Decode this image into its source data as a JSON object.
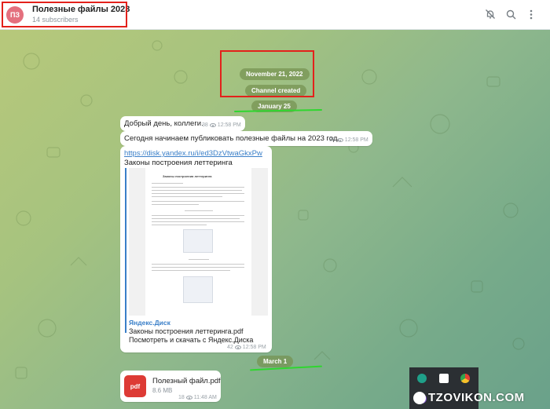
{
  "header": {
    "avatar_initials": "ПЗ",
    "title": "Полезные файлы 2023",
    "subtitle": "14 subscribers",
    "icons": [
      "mute-icon",
      "search-icon",
      "more-icon"
    ]
  },
  "service": {
    "date1": "November 21, 2022",
    "created": "Channel created",
    "date2": "January 25",
    "date3": "March 1"
  },
  "messages": [
    {
      "text": "Добрый день, коллеги.",
      "views": "38",
      "time": "12:58 PM"
    },
    {
      "text": "Сегодня начинаем публиковать полезные файлы на 2023 год.",
      "views": "38",
      "time": "12:58 PM"
    },
    {
      "link": "https://disk.yandex.ru/i/ed3DzVtwaGkxPw",
      "text": "Законы построения леттеринга",
      "preview_site": "Яндекс.Диск",
      "preview_title": "Законы построения леттеринга.pdf",
      "preview_desc": "Посмотреть и скачать с Яндекс.Диска",
      "doc_heading": "Законы построения леттеринга",
      "views": "42",
      "time": "12:58 PM"
    },
    {
      "file_name": "Полезный файл.pdf",
      "file_size": "8.6 MB",
      "file_ext": "pdf",
      "views": "18",
      "time": "11:48 AM"
    }
  ],
  "watermark": "TZOVIKON.COM",
  "colors": {
    "accent": "#3a7fc8",
    "avatar": "#e4707e",
    "highlight": "#e3211b",
    "underline": "#2fd62f",
    "pdf": "#dd3b35"
  }
}
